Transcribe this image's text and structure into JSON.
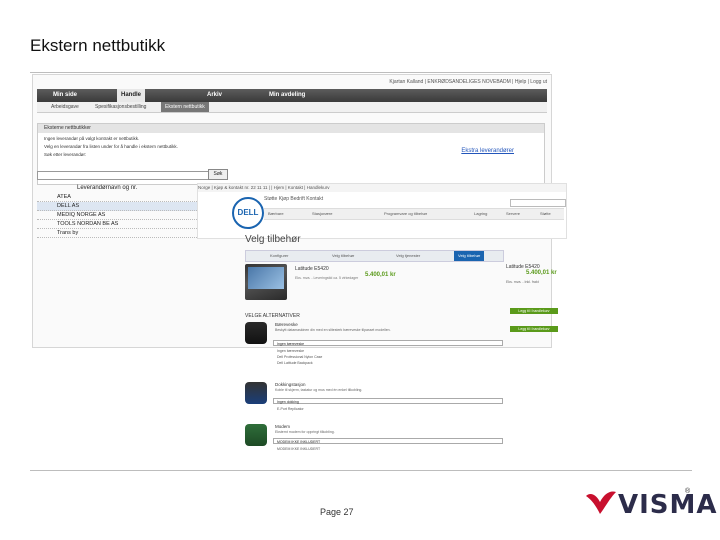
{
  "slide": {
    "title": "Ekstern nettbutikk",
    "page_label": "Page 27",
    "brand": "VISMA"
  },
  "back_shot": {
    "topline": "Kjartan Kalland | ENKRØDSANDELIGES NOVEBADM | Hjelp | Logg ut",
    "nav_tabs": [
      "Min side",
      "Handle",
      "Arkiv",
      "Min avdeling"
    ],
    "sub_tabs": [
      "Arbeidsgave",
      "Spesifikasjonsbestilling",
      "Ekstern nettbutikk"
    ],
    "panel_title": "Eksterne nettbutikker",
    "panel_lines": [
      "Ingen leverandør på valgt kontrakt er nettbutikk.",
      "Velg en leverandør fra listen under for å handle i ekstern nettbutikk.",
      "Søk etter leverandør:"
    ],
    "panel_link": "Ekstra leverandører",
    "search_button": "Søk",
    "supplier_heading": "Leverandørnavn og nr.",
    "suppliers": [
      "ATEA",
      "DELL AS",
      "MEDIQ NORGE AS",
      "TOOLS NORDAN BE AS",
      "Trans by"
    ]
  },
  "front_shot": {
    "topline": "Norge | Kjøp & kontakt nr. 22 11 11 | | Hjem | Kontakt | Handlekurv",
    "logo": "DELL",
    "nav": "Støtte   Kjøp   Bedrift   Kontakt",
    "menu": [
      "Bærbare",
      "Stasjonære",
      "Programvare og tilbehør",
      "Lagring",
      "Servere",
      "Støtte"
    ],
    "heading": "Velg tilbehør",
    "steps": [
      "Konfigurer",
      "Velg tilbehør",
      "Velg tjenester",
      "Velg tilbehør"
    ],
    "product_name": "Latitude E5420",
    "product_price": "5.400,01 kr",
    "product_fine": "Eks. mva. - Leveringstid ca. 5 virkedager",
    "side_name": "Latitude E5420",
    "side_price": "5.400,01 kr",
    "side_fine": "Eks. mva. - Inkl. frakt",
    "side_btn_1": "Legg til i handlekurv",
    "side_btn_2": "Legg til i handlekurv",
    "options_title": "VELGE ALTERNATIVER",
    "options": [
      {
        "name": "Bæreveske",
        "desc": "Beskytt datamaskinen din med en slitesterk bæreveske tilpasset modellen.",
        "select": "Ingen bæreveske",
        "radios": [
          "Ingen bæreveske",
          "Dell Professional Nylon Case",
          "Dell Latitude Backpack"
        ]
      },
      {
        "name": "Dokkingstasjon",
        "desc": "Koble til skjerm, tastatur og mus med én enkel tilkobling.",
        "select": "Ingen dokking",
        "radios": [
          "E-Port Replicator"
        ]
      },
      {
        "name": "Modem",
        "desc": "Eksternt modem for oppringt tilkobling.",
        "select": "MODEM IKKE INKLUDERT",
        "radios": [
          "MODEM IKKE INKLUDERT"
        ]
      }
    ]
  },
  "colors": {
    "accent_blue": "#1a64b0",
    "price_green": "#5a9a1a",
    "visma_red": "#c8102e"
  }
}
